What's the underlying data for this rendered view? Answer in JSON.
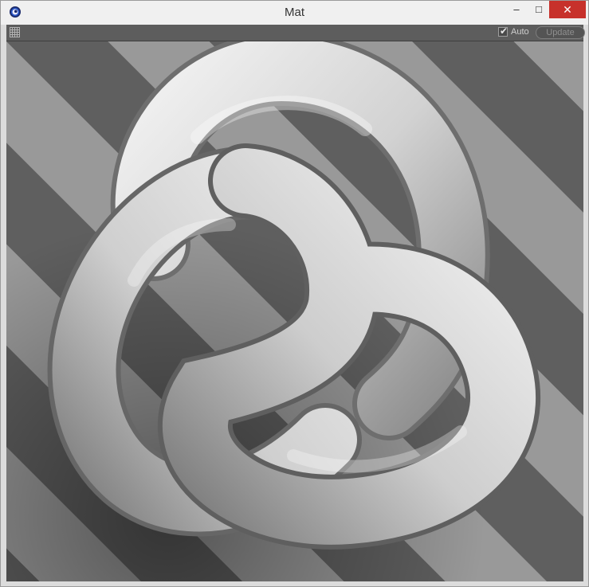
{
  "window": {
    "title": "Mat"
  },
  "toolbar": {
    "auto_label": "Auto",
    "auto_checked": true,
    "update_label": "Update"
  },
  "preview": {
    "object": "trefoil-knot"
  },
  "icons": {
    "app": "cinema4d-app-icon",
    "grip": "grid-grip-icon",
    "minimize": "minimize-icon",
    "maximize": "maximize-icon",
    "close": "close-icon",
    "check": "checkbox-check-icon"
  },
  "colors": {
    "stripe_dark": "#5f5f5f",
    "stripe_light": "#999999",
    "toolbar_bg": "#5d5d5d",
    "close_button": "#c7312b"
  }
}
